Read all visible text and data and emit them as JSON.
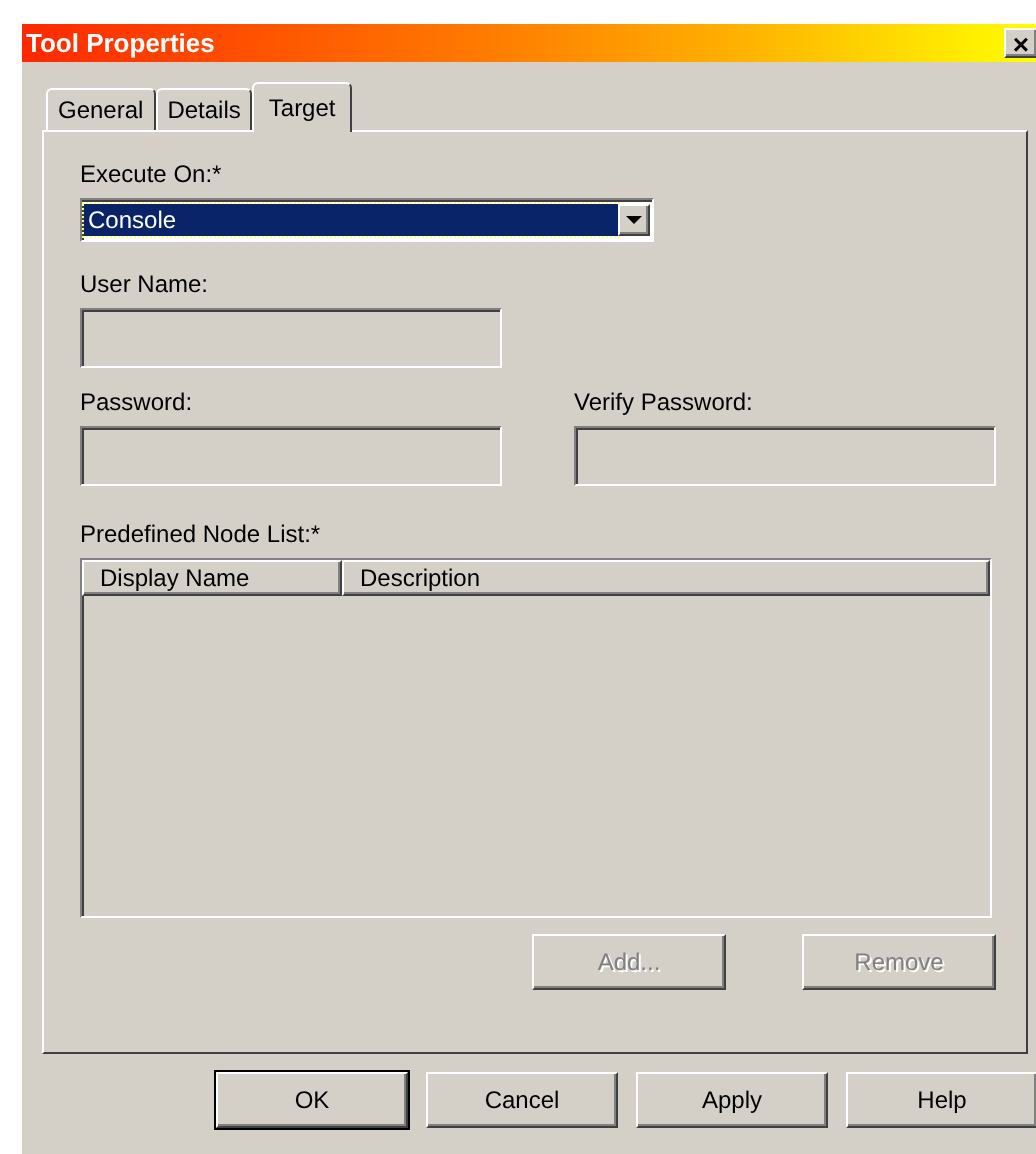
{
  "window": {
    "title": "Tool Properties",
    "close": "×"
  },
  "tabs": [
    {
      "label": "General",
      "selected": false
    },
    {
      "label": "Details",
      "selected": false
    },
    {
      "label": "Target",
      "selected": true
    }
  ],
  "execute_on": {
    "label": "Execute On:*",
    "value": "Console",
    "focused": true
  },
  "user_name": {
    "label": "User Name:",
    "disabled": true
  },
  "password": {
    "label": "Password:",
    "disabled": true
  },
  "verify_password": {
    "label": "Verify Password:",
    "disabled": true
  },
  "node_list": {
    "label": "Predefined Node List:*",
    "columns": [
      "Display Name",
      "Description"
    ]
  },
  "list_buttons": [
    {
      "label": "Add...",
      "disabled": true
    },
    {
      "label": "Remove",
      "disabled": true
    }
  ],
  "buttons": [
    {
      "label": "OK",
      "default": true
    },
    {
      "label": "Cancel",
      "default": false
    },
    {
      "label": "Apply",
      "default": false
    },
    {
      "label": "Help",
      "default": false
    }
  ]
}
